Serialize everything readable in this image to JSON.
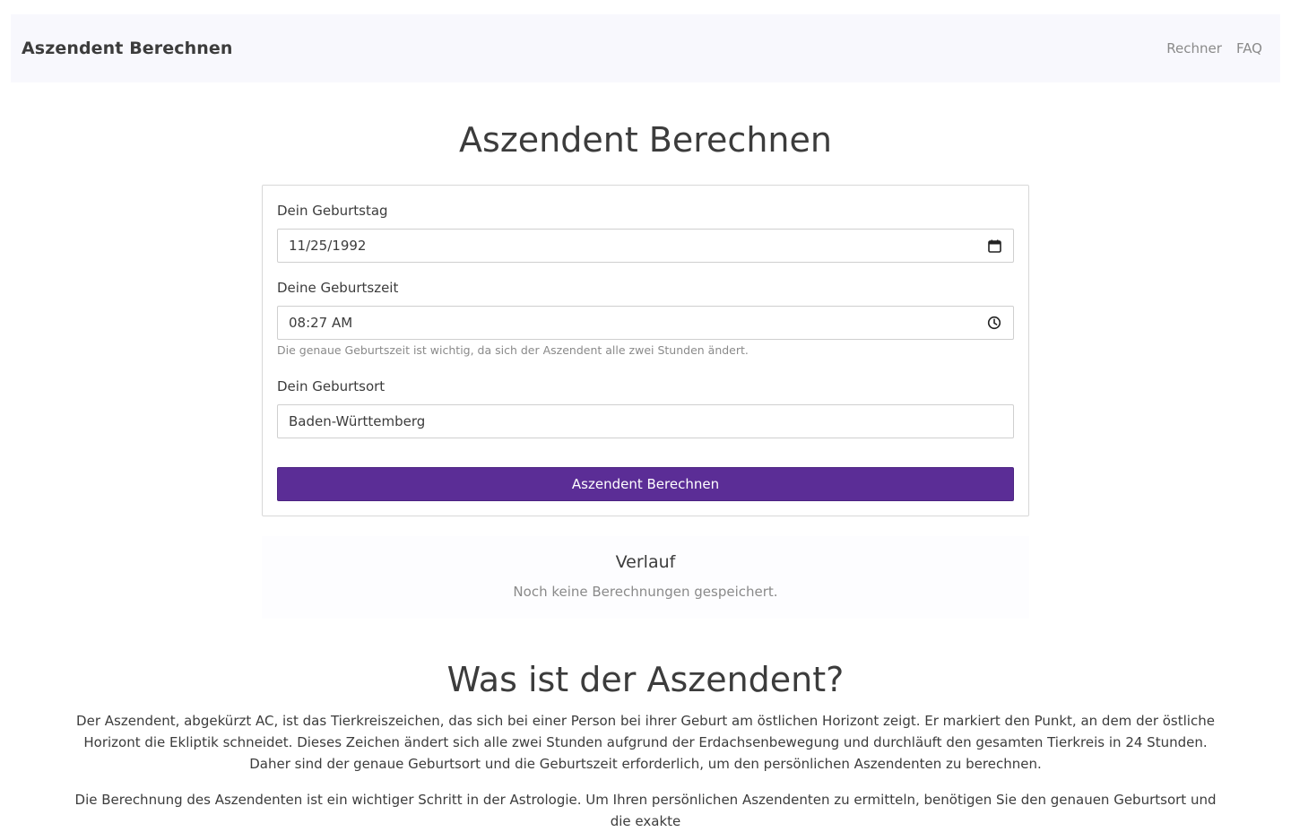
{
  "navbar": {
    "brand": "Aszendent Berechnen",
    "links": [
      "Rechner",
      "FAQ"
    ]
  },
  "page_title": "Aszendent Berechnen",
  "form": {
    "birthday_label": "Dein Geburtstag",
    "birthday_value": "11/25/1992",
    "birthtime_label": "Deine Geburtszeit",
    "birthtime_value": "08:27 AM",
    "birthtime_help": "Die genaue Geburtszeit ist wichtig, da sich der Aszendent alle zwei Stunden ändert.",
    "birthplace_label": "Dein Geburtsort",
    "birthplace_value": "Baden-Württemberg",
    "submit_label": "Aszendent Berechnen",
    "accent_color": "#5b2d96"
  },
  "history": {
    "title": "Verlauf",
    "empty_text": "Noch keine Berechnungen gespeichert."
  },
  "info": {
    "title": "Was ist der Aszendent?",
    "paragraphs": [
      "Der Aszendent, abgekürzt AC, ist das Tierkreiszeichen, das sich bei einer Person bei ihrer Geburt am östlichen Horizont zeigt. Er markiert den Punkt, an dem der östliche Horizont die Ekliptik schneidet. Dieses Zeichen ändert sich alle zwei Stunden aufgrund der Erdachsenbewegung und durchläuft den gesamten Tierkreis in 24 Stunden. Daher sind der genaue Geburtsort und die Geburtszeit erforderlich, um den persönlichen Aszendenten zu berechnen.",
      "Die Berechnung des Aszendenten ist ein wichtiger Schritt in der Astrologie. Um Ihren persönlichen Aszendenten zu ermitteln, benötigen Sie den genauen Geburtsort und die exakte"
    ]
  }
}
